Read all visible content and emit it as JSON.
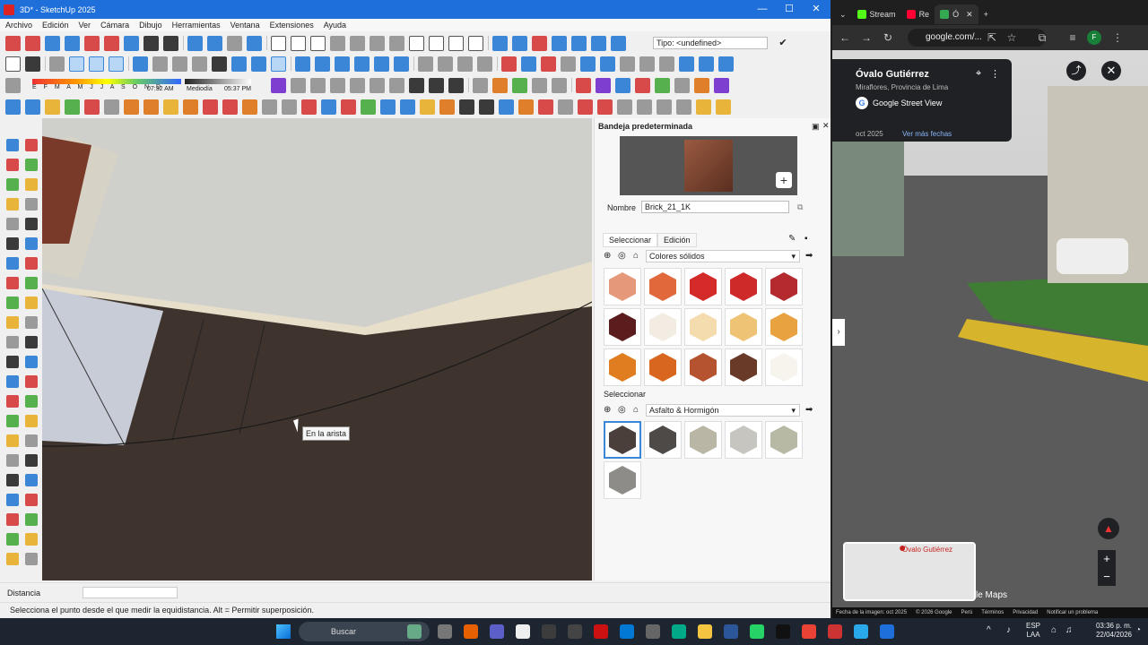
{
  "sketchup": {
    "title": "3D* - SketchUp 2025",
    "menu": [
      "Archivo",
      "Edición",
      "Ver",
      "Cámara",
      "Dibujo",
      "Herramientas",
      "Ventana",
      "Extensiones",
      "Ayuda"
    ],
    "type_label": "Tipo: <undefined>",
    "shadow": {
      "months": "E F M A M J J A S O N D",
      "time_start": "07:32 AM",
      "time_mid": "Mediodía",
      "time_end": "05:37 PM"
    },
    "viewport": {
      "tooltip": "En la arista"
    },
    "tray": {
      "title": "Bandeja predeterminada",
      "name_label": "Nombre",
      "name_value": "Brick_21_1K",
      "tab_select": "Seleccionar",
      "tab_edit": "Edición",
      "library1": "Colores sólidos",
      "select2": "Seleccionar",
      "library2": "Asfalto & Hormigón",
      "swatches1": [
        "#e5997a",
        "#e0683a",
        "#d42a2a",
        "#cf2a2a",
        "#b42a2f",
        "#5a1c1c",
        "#f2ece2",
        "#f4dcae",
        "#eec375",
        "#e8a340",
        "#e07d20",
        "#d8661e",
        "#b5522f",
        "#6a3a28",
        "#f6f4ec"
      ],
      "swatches2": [
        "#4a3f3a",
        "#4d4a47",
        "#b9b6a6",
        "#c6c5c0",
        "#b8b9a5",
        "#8e8c88"
      ]
    },
    "status": {
      "distance_label": "Distancia",
      "message": "Selecciona el punto desde el que medir la equidistancia. Alt = Permitir superposición."
    }
  },
  "chrome": {
    "tabs": [
      "Stream",
      "Re",
      "Ó"
    ],
    "url": "google.com/...",
    "place": "Óvalo Gutiérrez",
    "place_sub": "Miraflores, Provincia de Lima",
    "sv_label": "Google Street View",
    "sv_date": "oct 2025",
    "sv_more": "Ver más fechas",
    "minimap_label": "Óvalo Gutiérrez",
    "maps_text": "le Maps",
    "footer": [
      "Fecha de la imagen: oct 2025",
      "© 2026 Google",
      "Perú",
      "Términos",
      "Privacidad",
      "Notificar un problema"
    ]
  },
  "taskbar": {
    "search": "Buscar",
    "lang1": "ESP",
    "lang2": "LAA",
    "time": "03:36 p. m.",
    "date": "22/04/2026"
  }
}
